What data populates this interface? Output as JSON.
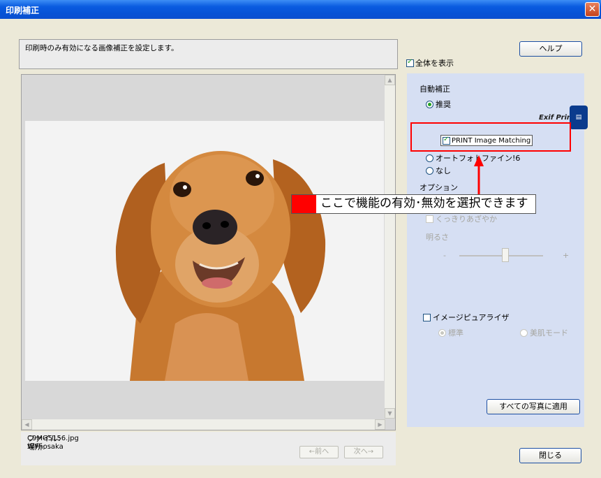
{
  "window": {
    "title": "印刷補正",
    "close_symbol": "✕"
  },
  "description": "印刷時のみ有効になる画像補正を設定します。",
  "help_button": "ヘルプ",
  "show_all": {
    "label": "全体を表示",
    "checked": true
  },
  "file_info": {
    "file_label": "ファイル:",
    "file_value": "C9MG5156.jpg",
    "location_label": "場所:",
    "location_value": "W¥hosaka"
  },
  "nav": {
    "prev": "←前へ",
    "next": "次へ→"
  },
  "auto_correction": {
    "heading": "自動補正",
    "recommended": "推奨",
    "pim_label": "PRINT Image Matching",
    "exif_text": "Exif Print",
    "auto_photo_fine": "オートフォトファイン!6",
    "none": "なし"
  },
  "options": {
    "heading": "オプション",
    "sharp_vivid": "くっきりあざやか",
    "brightness": "明るさ",
    "minus": "-",
    "plus": "+",
    "brightness_value": 0.55
  },
  "image_equalizer": {
    "label": "イメージピュアライザ",
    "standard": "標準",
    "beauty_mode": "美肌モード"
  },
  "apply_all_button": "すべての写真に適用",
  "close_button": "閉じる",
  "callout_text": "ここで機能の有効･無効を選択できます",
  "colors": {
    "highlight": "#ff0000",
    "titlebar": "#0653d6",
    "panel": "#d6dff3"
  },
  "icons": {
    "close": "close-icon",
    "scroll_up": "scroll-up-icon",
    "scroll_down": "scroll-down-icon",
    "scroll_left": "scroll-left-icon",
    "scroll_right": "scroll-right-icon",
    "exif_logo": "exif-print-logo"
  }
}
